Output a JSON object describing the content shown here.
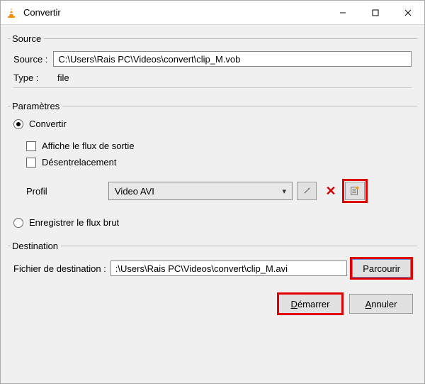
{
  "titlebar": {
    "app_icon": "vlc-cone-icon",
    "title": "Convertir"
  },
  "source": {
    "legend": "Source",
    "source_label": "Source :",
    "source_value": "C:\\Users\\Rais PC\\Videos\\convert\\clip_M.vob",
    "type_label": "Type :",
    "type_value": "file"
  },
  "params": {
    "legend": "Paramètres",
    "radio_convert_label": "Convertir",
    "check_show_output_label": "Affiche le flux de sortie",
    "check_deinterlace_label": "Désentrelacement",
    "profile_label": "Profil",
    "profile_selected": "Video AVI",
    "radio_raw_label": "Enregistrer le flux brut"
  },
  "destination": {
    "legend": "Destination",
    "dest_label": "Fichier de destination :",
    "dest_value": ":\\Users\\Rais PC\\Videos\\convert\\clip_M.avi",
    "browse_label": "Parcourir"
  },
  "footer": {
    "start_label": "Démarrer",
    "cancel_label": "Annuler"
  }
}
